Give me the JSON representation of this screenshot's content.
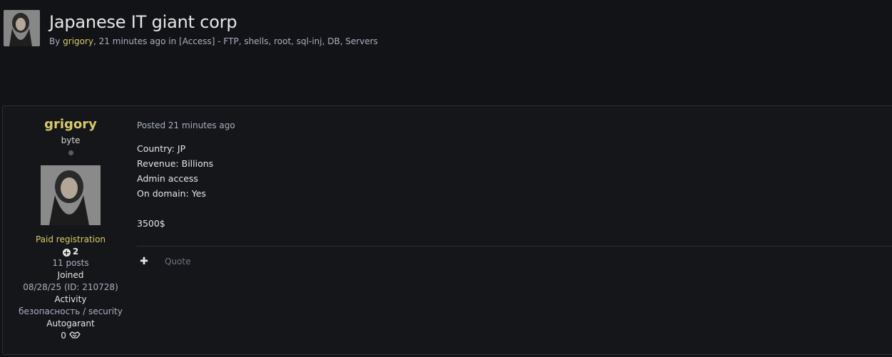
{
  "topic": {
    "title": "Japanese IT giant corp",
    "meta_by": "By ",
    "author": "grigory",
    "meta_time": ", 21 minutes ago in ",
    "forum": "[Access] - FTP, shells, root, sql-inj, DB, Servers"
  },
  "post": {
    "author": {
      "name": "grigory",
      "rank": "byte",
      "group": "Paid registration",
      "reputation": "2",
      "posts": "11 posts",
      "joined_label": "Joined",
      "joined_value": "08/28/25 (ID: 210728)",
      "activity_label": "Activity",
      "activity_value": "безопасность / security",
      "autogarant_label": "Autogarant",
      "autogarant_value": "0"
    },
    "posted": "Posted 21 minutes ago",
    "body": [
      "Country: JP",
      "Revenue: Billions",
      "Admin access",
      "On domain: Yes",
      "",
      "3500$"
    ],
    "actions": {
      "plus": "✚",
      "quote": "Quote"
    }
  },
  "colors": {
    "accent": "#d9c96a",
    "background": "#121317",
    "muted": "#a8b0bd"
  },
  "icons": [
    "avatar-photo",
    "plus-circle-icon",
    "handshake-icon",
    "plus-icon"
  ]
}
